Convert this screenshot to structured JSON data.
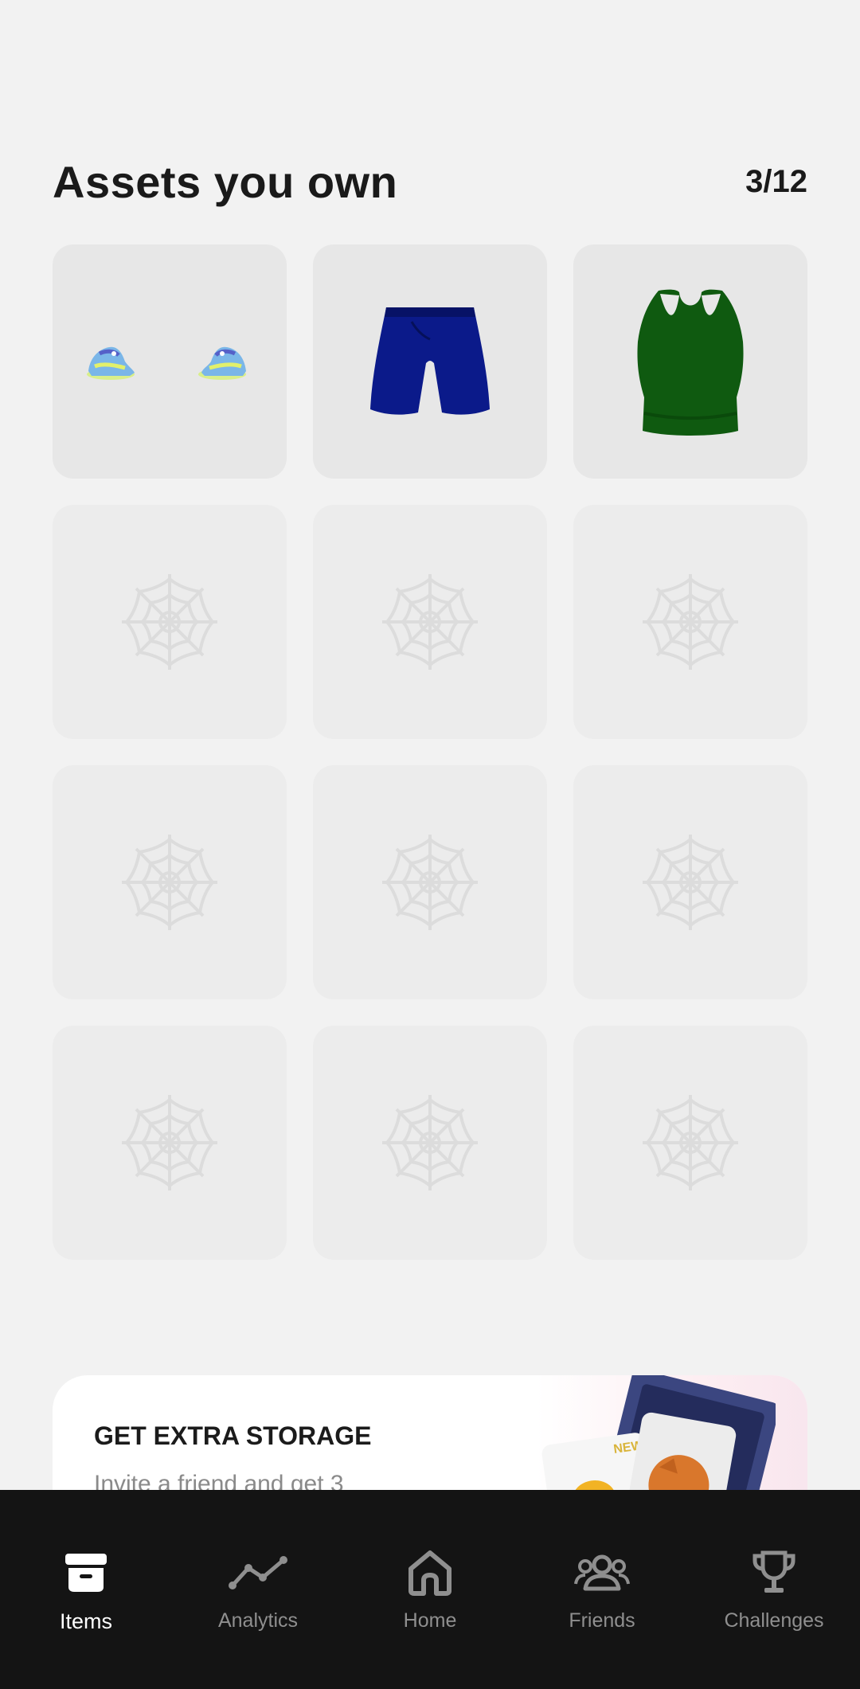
{
  "header": {
    "title": "Assets you own",
    "count": "3/12"
  },
  "assets": [
    {
      "name": "sneakers",
      "icon": "sneakers-icon",
      "owned": true
    },
    {
      "name": "shorts",
      "icon": "shorts-icon",
      "owned": true
    },
    {
      "name": "tank-top",
      "icon": "tank-top-icon",
      "owned": true
    },
    {
      "icon": "spiderweb-icon",
      "owned": false
    },
    {
      "icon": "spiderweb-icon",
      "owned": false
    },
    {
      "icon": "spiderweb-icon",
      "owned": false
    },
    {
      "icon": "spiderweb-icon",
      "owned": false
    },
    {
      "icon": "spiderweb-icon",
      "owned": false
    },
    {
      "icon": "spiderweb-icon",
      "owned": false
    },
    {
      "icon": "spiderweb-icon",
      "owned": false
    },
    {
      "icon": "spiderweb-icon",
      "owned": false
    },
    {
      "icon": "spiderweb-icon",
      "owned": false
    }
  ],
  "promo": {
    "title": "GET EXTRA STORAGE",
    "text": "Invite a friend and get 3",
    "badge": "NEW"
  },
  "nav": {
    "items": [
      {
        "label": "Items",
        "icon": "archive-box-icon",
        "active": true
      },
      {
        "label": "Analytics",
        "icon": "line-chart-icon",
        "active": false
      },
      {
        "label": "Home",
        "icon": "home-icon",
        "active": false
      },
      {
        "label": "Friends",
        "icon": "friends-icon",
        "active": false
      },
      {
        "label": "Challenges",
        "icon": "trophy-icon",
        "active": false
      }
    ]
  },
  "colors": {
    "background": "#f2f2f2",
    "nav_background": "#141414",
    "shorts": "#0b1a8a",
    "tank_top": "#0f5a10"
  }
}
